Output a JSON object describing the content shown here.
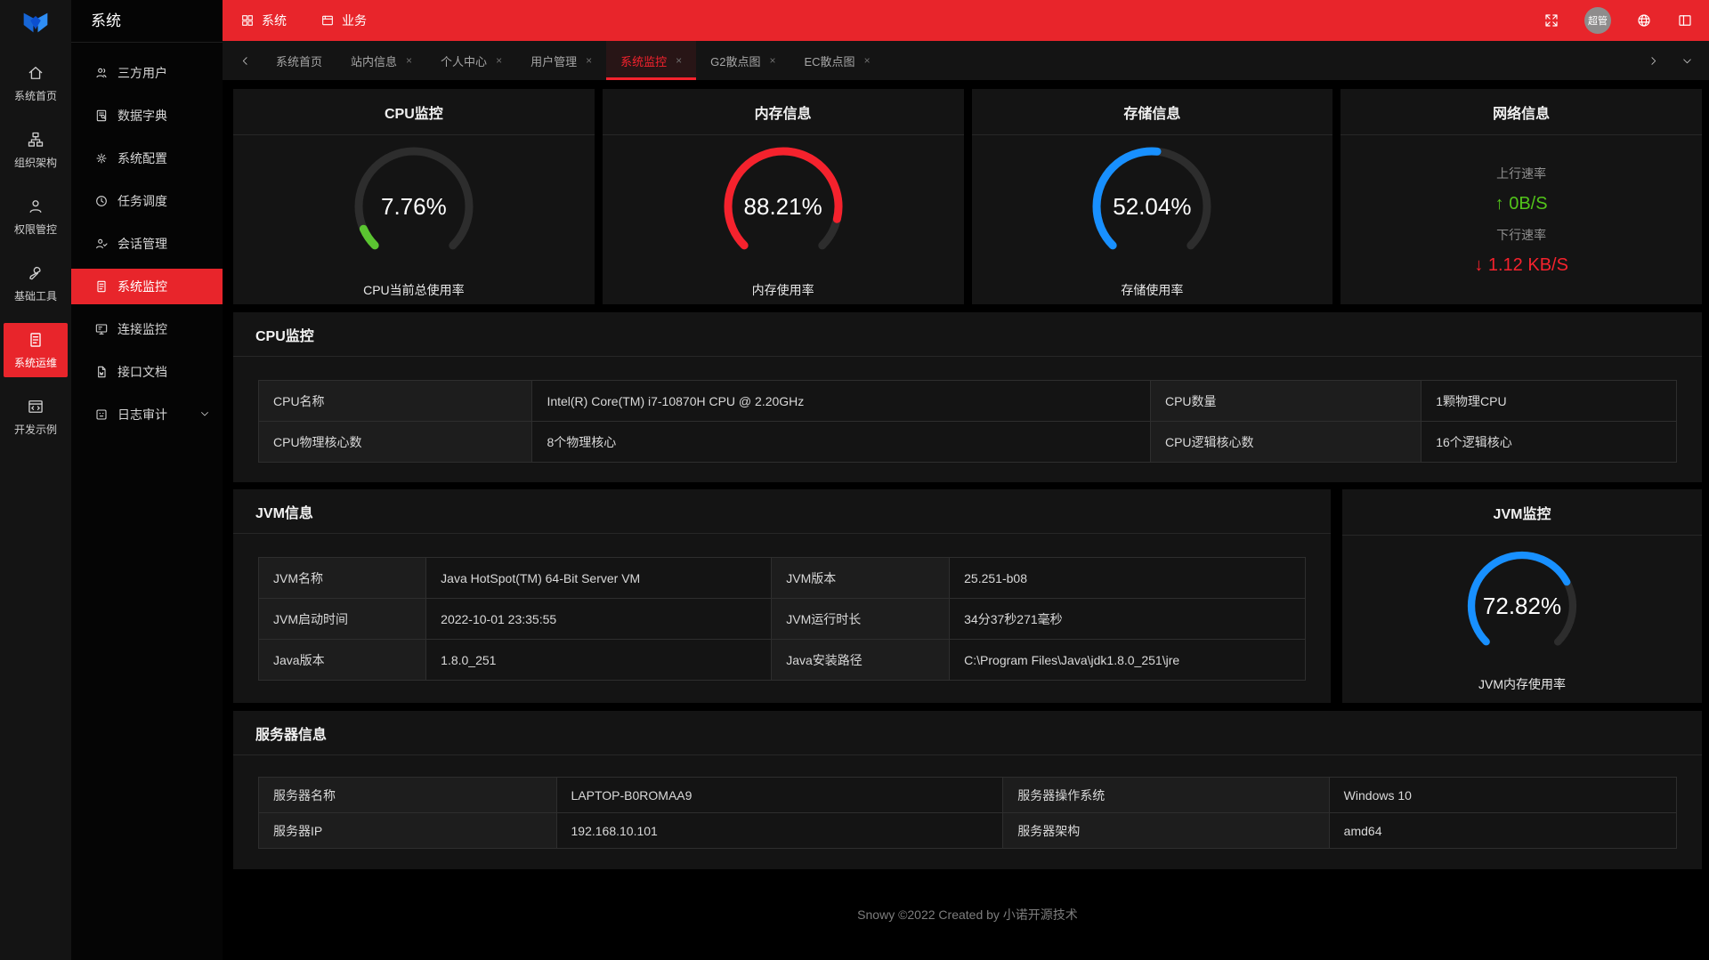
{
  "colors": {
    "accent": "#e8252b",
    "tab_active": "#f5222d",
    "up_green": "#52c41a",
    "down_red": "#f5222d"
  },
  "sidebar": {
    "items": [
      {
        "label": "系统首页",
        "active": false
      },
      {
        "label": "组织架构",
        "active": false
      },
      {
        "label": "权限管控",
        "active": false
      },
      {
        "label": "基础工具",
        "active": false
      },
      {
        "label": "系统运维",
        "active": true
      },
      {
        "label": "开发示例",
        "active": false
      }
    ]
  },
  "menu": {
    "title": "系统",
    "items": [
      {
        "label": "三方用户"
      },
      {
        "label": "数据字典"
      },
      {
        "label": "系统配置"
      },
      {
        "label": "任务调度"
      },
      {
        "label": "会话管理"
      },
      {
        "label": "系统监控",
        "active": true
      },
      {
        "label": "连接监控"
      },
      {
        "label": "接口文档"
      },
      {
        "label": "日志审计",
        "has_children": true
      }
    ]
  },
  "topbar": {
    "tabs": [
      {
        "label": "系统"
      },
      {
        "label": "业务"
      }
    ],
    "avatar": "超管"
  },
  "tabbar": {
    "close_glyph": "×",
    "tabs": [
      {
        "label": "系统首页",
        "closable": false,
        "active": false
      },
      {
        "label": "站内信息",
        "closable": true,
        "active": false
      },
      {
        "label": "个人中心",
        "closable": true,
        "active": false
      },
      {
        "label": "用户管理",
        "closable": true,
        "active": false
      },
      {
        "label": "系统监控",
        "closable": true,
        "active": true
      },
      {
        "label": "G2散点图",
        "closable": true,
        "active": false
      },
      {
        "label": "EC散点图",
        "closable": true,
        "active": false
      }
    ]
  },
  "gauges": {
    "cpu": {
      "title": "CPU监控",
      "value": 7.76,
      "display": "7.76%",
      "color": "#5bc531",
      "caption": "CPU当前总使用率"
    },
    "memory": {
      "title": "内存信息",
      "value": 88.21,
      "display": "88.21%",
      "color": "#f5222d",
      "caption": "内存使用率"
    },
    "storage": {
      "title": "存储信息",
      "value": 52.04,
      "display": "52.04%",
      "color": "#1890ff",
      "caption": "存储使用率"
    },
    "jvm": {
      "title": "JVM监控",
      "value": 72.82,
      "display": "72.82%",
      "color": "#1890ff",
      "caption": "JVM内存使用率"
    }
  },
  "network": {
    "title": "网络信息",
    "up_label": "上行速率",
    "up_arrow": "↑",
    "up_value": "0B/S",
    "down_label": "下行速率",
    "down_arrow": "↓",
    "down_value": "1.12 KB/S"
  },
  "panels": {
    "cpu": {
      "title": "CPU监控",
      "rows": [
        [
          "CPU名称",
          "Intel(R) Core(TM) i7-10870H CPU @ 2.20GHz",
          "CPU数量",
          "1颗物理CPU"
        ],
        [
          "CPU物理核心数",
          "8个物理核心",
          "CPU逻辑核心数",
          "16个逻辑核心"
        ]
      ]
    },
    "jvm": {
      "title": "JVM信息",
      "rows": [
        [
          "JVM名称",
          "Java HotSpot(TM) 64-Bit Server VM",
          "JVM版本",
          "25.251-b08"
        ],
        [
          "JVM启动时间",
          "2022-10-01 23:35:55",
          "JVM运行时长",
          "34分37秒271毫秒"
        ],
        [
          "Java版本",
          "1.8.0_251",
          "Java安装路径",
          "C:\\Program Files\\Java\\jdk1.8.0_251\\jre"
        ]
      ]
    },
    "server": {
      "title": "服务器信息",
      "rows": [
        [
          "服务器名称",
          "LAPTOP-B0ROMAA9",
          "服务器操作系统",
          "Windows 10"
        ],
        [
          "服务器IP",
          "192.168.10.101",
          "服务器架构",
          "amd64"
        ]
      ]
    }
  },
  "footer": {
    "text": "Snowy ©2022 Created by 小诺开源技术"
  }
}
